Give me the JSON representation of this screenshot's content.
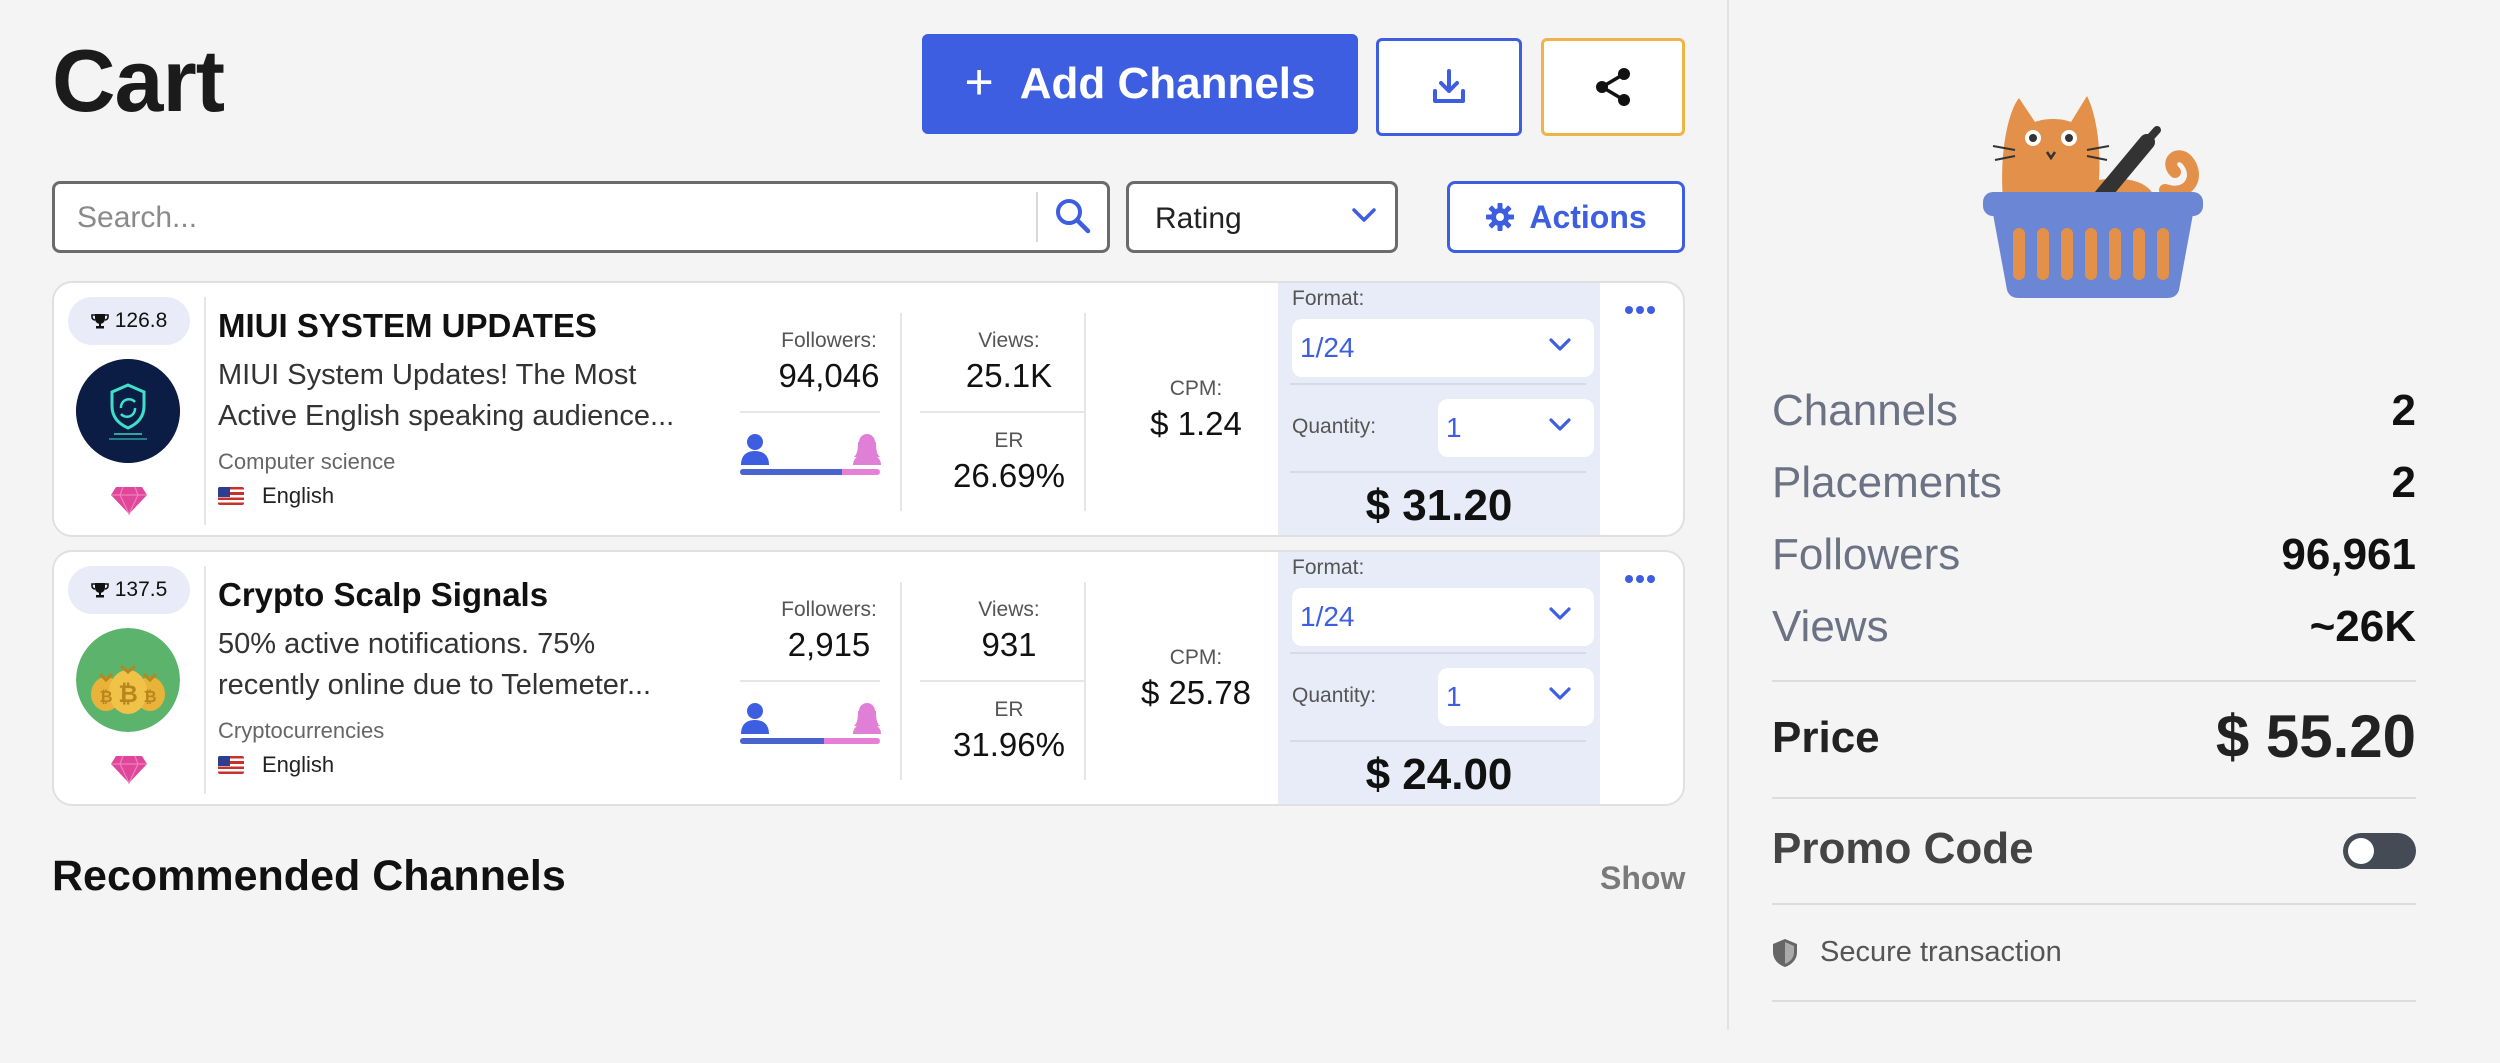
{
  "header": {
    "title": "Cart",
    "add_channels_label": "Add Channels",
    "download_icon": "download-icon",
    "share_icon": "share-icon"
  },
  "toolbar": {
    "search_placeholder": "Search...",
    "search_icon": "search-icon",
    "sort_value": "Rating",
    "actions_label": "Actions",
    "actions_icon": "gear-icon"
  },
  "cards": [
    {
      "rating": "126.8",
      "name": "MIUI SYSTEM UPDATES",
      "description_line1": "MIUI System Updates! The Most",
      "description_line2": "Active English speaking audience...",
      "category": "Computer science",
      "language": "English",
      "followers_label": "Followers:",
      "followers": "94,046",
      "male_share": 0.73,
      "views_label": "Views:",
      "views": "25.1K",
      "er_label": "ER",
      "er": "26.69%",
      "cpm_label": "CPM:",
      "cpm": "$ 1.24",
      "format_label": "Format:",
      "format": "1/24",
      "quantity_label": "Quantity:",
      "quantity": "1",
      "total": "$ 31.20"
    },
    {
      "rating": "137.5",
      "name": "Crypto Scalp Signals",
      "description_line1": "50% active notifications. 75%",
      "description_line2": "recently online due to Telemeter...",
      "category": "Cryptocurrencies",
      "language": "English",
      "followers_label": "Followers:",
      "followers": "2,915",
      "male_share": 0.6,
      "views_label": "Views:",
      "views": "931",
      "er_label": "ER",
      "er": "31.96%",
      "cpm_label": "CPM:",
      "cpm": "$ 25.78",
      "format_label": "Format:",
      "format": "1/24",
      "quantity_label": "Quantity:",
      "quantity": "1",
      "total": "$ 24.00"
    }
  ],
  "recommended": {
    "title": "Recommended Channels",
    "show_label": "Show"
  },
  "summary": {
    "channels_label": "Channels",
    "channels": "2",
    "placements_label": "Placements",
    "placements": "2",
    "followers_label": "Followers",
    "followers": "96,961",
    "views_label": "Views",
    "views": "~26K",
    "price_label": "Price",
    "price": "$ 55.20",
    "promo_label": "Promo Code",
    "promo_enabled": false,
    "secure_label": "Secure transaction"
  },
  "colors": {
    "accent": "#3d5ee0",
    "share_border": "#f0b347",
    "price_panel": "#e8ecf8",
    "gem": "#e0479a"
  }
}
